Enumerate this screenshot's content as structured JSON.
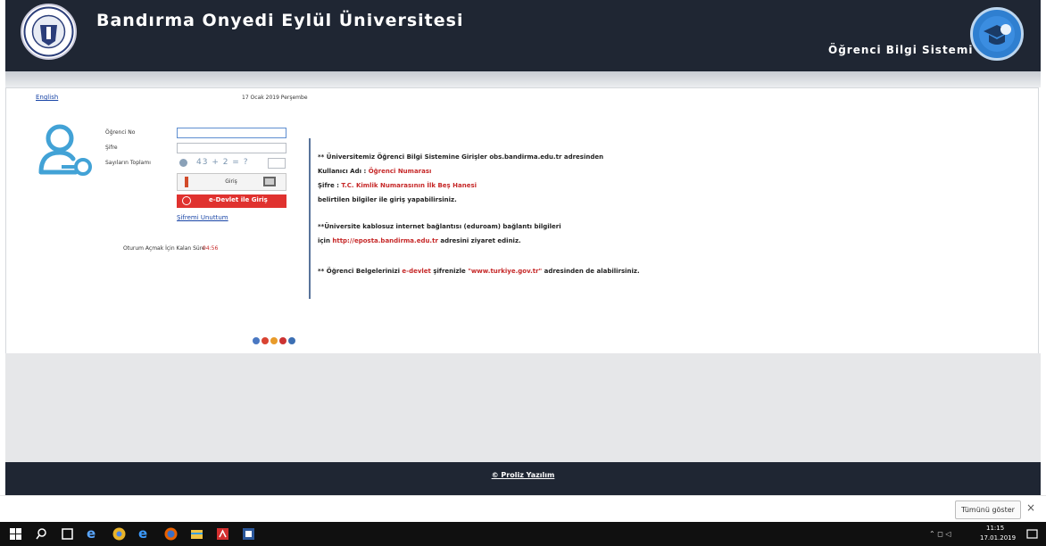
{
  "header": {
    "title": "Bandırma Onyedi Eylül Üniversitesi",
    "subtitle": "Öğrenci Bilgi Sistemi"
  },
  "top": {
    "language_link": "English",
    "date": "17 Ocak 2019 Perşembe"
  },
  "login": {
    "student_no_label": "Öğrenci No",
    "password_label": "Şifre",
    "captcha_label": "Sayıların Toplamı",
    "captcha_text": "43 + 2 = ?",
    "login_button": "Giriş",
    "edevlet_button": "e-Devlet ile Giriş",
    "forgot_password": "Şifremi Unuttum",
    "session_label": "Oturum Açmak İçin Kalan Süre",
    "session_time": "04:56"
  },
  "info": {
    "line1": "** Üniversitemiz Öğrenci Bilgi Sistemine Girişler obs.bandirma.edu.tr adresinden",
    "line2_prefix": "Kullanıcı Adı : ",
    "line2_value": "Öğrenci Numarası",
    "line3_prefix": "Şifre : ",
    "line3_value": "T.C. Kimlik Numarasının İlk Beş Hanesi",
    "line4": "belirtilen bilgiler ile giriş yapabilirsiniz.",
    "line5": "**Üniversite kablosuz internet bağlantısı (eduroam) bağlantı bilgileri",
    "line6_prefix": "için ",
    "line6_link": "http://eposta.bandirma.edu.tr",
    "line6_suffix": " adresini ziyaret ediniz.",
    "line7_prefix": "** Öğrenci Belgelerinizi ",
    "line7_red1": "e-devlet",
    "line7_mid": " şifrenizle ",
    "line7_red2": "\"www.turkiye.gov.tr\"",
    "line7_suffix": " adresinden de alabilirsiniz."
  },
  "footer": {
    "text": "© Proliz Yazılım"
  },
  "notification": {
    "show_all": "Tümünü göster",
    "close": "×"
  },
  "taskbar": {
    "time": "11:15",
    "date": "17.01.2019"
  },
  "colors": {
    "header_bg": "#1f2633",
    "accent_red": "#c62828",
    "link_blue": "#1a46a7"
  }
}
